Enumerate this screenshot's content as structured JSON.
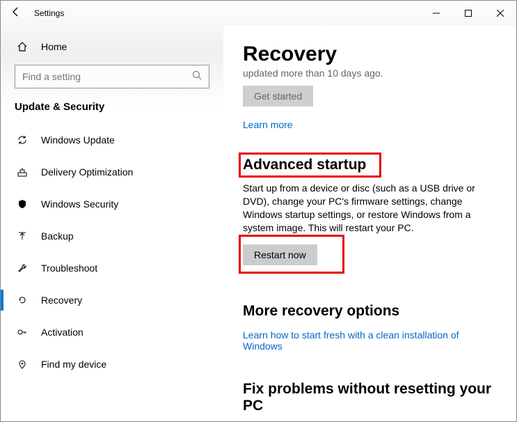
{
  "titlebar": {
    "app": "Settings"
  },
  "sidebar": {
    "home": "Home",
    "search_placeholder": "Find a setting",
    "section": "Update & Security",
    "items": [
      {
        "icon": "sync",
        "label": "Windows Update"
      },
      {
        "icon": "deliver",
        "label": "Delivery Optimization"
      },
      {
        "icon": "shield",
        "label": "Windows Security"
      },
      {
        "icon": "backup",
        "label": "Backup"
      },
      {
        "icon": "trouble",
        "label": "Troubleshoot"
      },
      {
        "icon": "recover",
        "label": "Recovery"
      },
      {
        "icon": "activ",
        "label": "Activation"
      },
      {
        "icon": "find",
        "label": "Find my device"
      }
    ]
  },
  "content": {
    "title": "Recovery",
    "truncated_text": "updated more than 10 days ago.",
    "get_started": "Get started",
    "learn_more": "Learn more",
    "adv_heading": "Advanced startup",
    "adv_para": "Start up from a device or disc (such as a USB drive or DVD), change your PC's firmware settings, change Windows startup settings, or restore Windows from a system image. This will restart your PC.",
    "restart_now": "Restart now",
    "more_heading": "More recovery options",
    "more_link": "Learn how to start fresh with a clean installation of Windows",
    "fix_heading": "Fix problems without resetting your PC"
  }
}
